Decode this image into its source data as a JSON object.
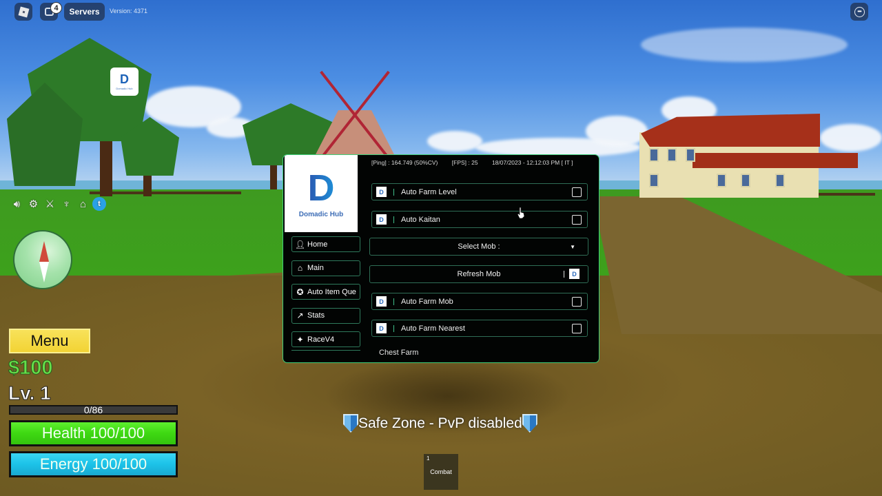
{
  "topbar": {
    "chat_badge_count": "4",
    "servers_label": "Servers",
    "version_text": "Version: 4371"
  },
  "hub_toggle": {
    "caption": "Domadic Hub"
  },
  "left_icons": [
    "speaker-icon",
    "gear-icon",
    "crossed-swords-skull-icon",
    "trophy-icon",
    "home-icon",
    "twitter-icon"
  ],
  "hud": {
    "menu_label": "Menu",
    "money": "$100",
    "level": "Lv. 1",
    "xp_text": "0/86",
    "xp_fraction": 0.0,
    "health_text": "Health 100/100",
    "health_fraction": 1.0,
    "energy_text": "Energy 100/100",
    "energy_fraction": 1.0,
    "colors": {
      "health": "#3ed812",
      "energy": "#1cc2e8",
      "menu": "#f2d334",
      "money": "#66e04a"
    }
  },
  "safe_zone_text": "Safe Zone - PvP disabled",
  "hotbar": [
    {
      "slot": "1",
      "label": "Combat"
    }
  ],
  "hub": {
    "title": "Domadic Hub",
    "accent_color": "#3fd07a",
    "status": {
      "ping": "[Ping] : 164.749 (50%CV)",
      "fps": "[FPS] : 25",
      "datetime": "18/07/2023 - 12:12:03 PM [ IT ]"
    },
    "tabs": [
      {
        "label": "Home",
        "icon": "avatar-icon"
      },
      {
        "label": "Main",
        "icon": "home-icon"
      },
      {
        "label": "Auto Item Que",
        "icon": "medal-icon"
      },
      {
        "label": "Stats",
        "icon": "chart-icon"
      },
      {
        "label": "RaceV4",
        "icon": "race-icon"
      }
    ],
    "content": {
      "toggles_top": [
        {
          "label": "Auto Farm Level",
          "checked": false
        },
        {
          "label": "Auto Kaitan",
          "checked": false
        }
      ],
      "select_mob_label": "Select Mob :",
      "refresh_mob_label": "Refresh Mob",
      "toggles_bottom": [
        {
          "label": "Auto Farm Mob",
          "checked": false
        },
        {
          "label": "Auto Farm Nearest",
          "checked": false
        }
      ],
      "section_chest": "Chest Farm"
    }
  }
}
